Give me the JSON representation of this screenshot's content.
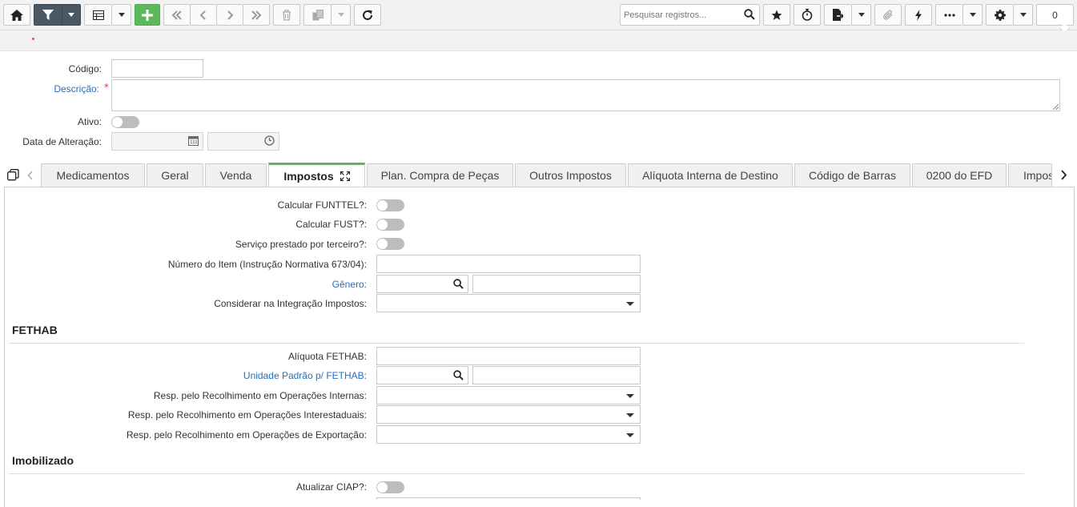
{
  "toolbar": {
    "search_placeholder": "Pesquisar registros...",
    "record_count": "0"
  },
  "form": {
    "codigo_label": "Código:",
    "descricao_label": "Descrição:",
    "required_mark": "*",
    "ativo_label": "Ativo:",
    "data_alteracao_label": "Data de Alteração:"
  },
  "tabs": [
    {
      "label": "Medicamentos"
    },
    {
      "label": "Geral"
    },
    {
      "label": "Venda"
    },
    {
      "label": "Impostos"
    },
    {
      "label": "Plan. Compra de Peças"
    },
    {
      "label": "Outros Impostos"
    },
    {
      "label": "Alíquota Interna de Destino"
    },
    {
      "label": "Código de Barras"
    },
    {
      "label": "0200 do EFD"
    },
    {
      "label": "Impos"
    }
  ],
  "impostos": {
    "calcular_funttel": "Calcular FUNTTEL?:",
    "calcular_fust": "Calcular FUST?:",
    "servico_terceiro": "Serviço prestado por terceiro?:",
    "numero_item": "Número do Item (Instrução Normativa 673/04):",
    "genero": "Gênero:",
    "considerar_integracao": "Considerar na Integração Impostos:"
  },
  "fethab": {
    "title": "FETHAB",
    "aliquota": "Alíquota FETHAB:",
    "unidade_padrao": "Unidade Padrão p/ FETHAB:",
    "resp_internas": "Resp. pelo Recolhimento em Operações Internas:",
    "resp_interestaduais": "Resp. pelo Recolhimento em Operações Interestaduais:",
    "resp_exportacao": "Resp. pelo Recolhimento em Operações de Exportação:"
  },
  "imobilizado": {
    "title": "Imobilizado",
    "atualizar_ciap": "Atualizar CIAP?:"
  }
}
